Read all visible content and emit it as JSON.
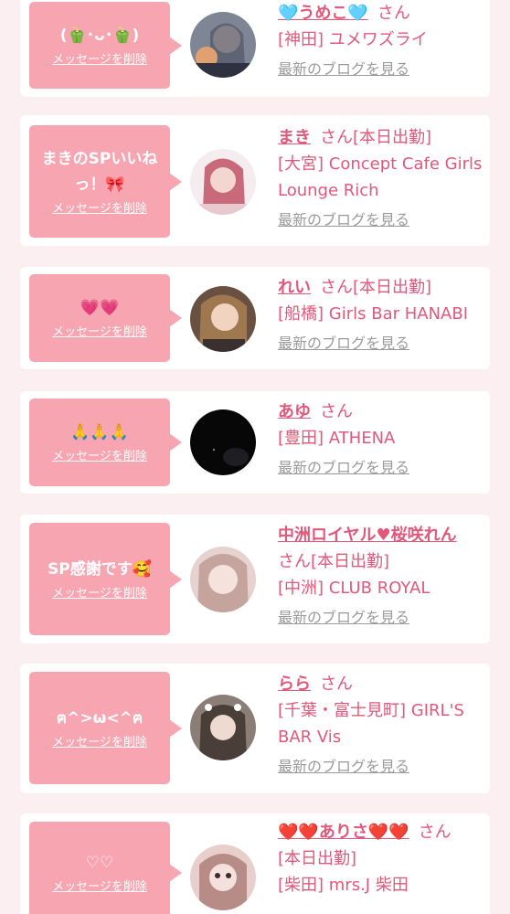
{
  "common": {
    "delete_label": "メッセージを削除",
    "blog_label": "最新のブログを見る",
    "san": "さん"
  },
  "colors": {
    "background": "#fbeff2",
    "bubble": "#f8a5b2",
    "accent": "#e2587a",
    "link_gray": "#9a9a9a"
  },
  "items": [
    {
      "message": "(🫑･ᴗ･🫑)",
      "name": "🩵うめこ🩵",
      "suffix": "さん",
      "shop": "[神田] ユメワズライ",
      "avatar_icon": "girl-photo-icon"
    },
    {
      "message": "まきのSPいいねっ！🎀",
      "name": "まき",
      "suffix": "さん[本日出勤]",
      "shop": "[大宮] Concept Cafe Girls Lounge Rich",
      "avatar_icon": "girl-photo-icon"
    },
    {
      "message": "💗💗",
      "name": "れい",
      "suffix": "さん[本日出勤]",
      "shop": "[船橋] Girls Bar HANABI",
      "avatar_icon": "girl-photo-icon"
    },
    {
      "message": "🙏🙏🙏",
      "name": "あゆ",
      "suffix": "さん",
      "shop": "[豊田] ATHENA",
      "avatar_icon": "dark-photo-icon"
    },
    {
      "message": "SP感謝です🥰",
      "name": "中洲ロイヤル♥桜咲れん",
      "suffix": "さん[本日出勤]",
      "shop": "[中洲] CLUB ROYAL",
      "avatar_icon": "girl-photo-icon"
    },
    {
      "message": "ฅ^>ω<^ฅ",
      "name": "らら",
      "suffix": "さん",
      "shop": "[千葉・富士見町] GIRL'S BAR Vis",
      "avatar_icon": "girl-photo-icon"
    },
    {
      "message": "♡♡",
      "name": "❤️❤️ありさ❤️❤️",
      "suffix": "さん",
      "status": "[本日出勤]",
      "shop": "[柴田] mrs.J 柴田",
      "avatar_icon": "girl-photo-icon"
    }
  ]
}
